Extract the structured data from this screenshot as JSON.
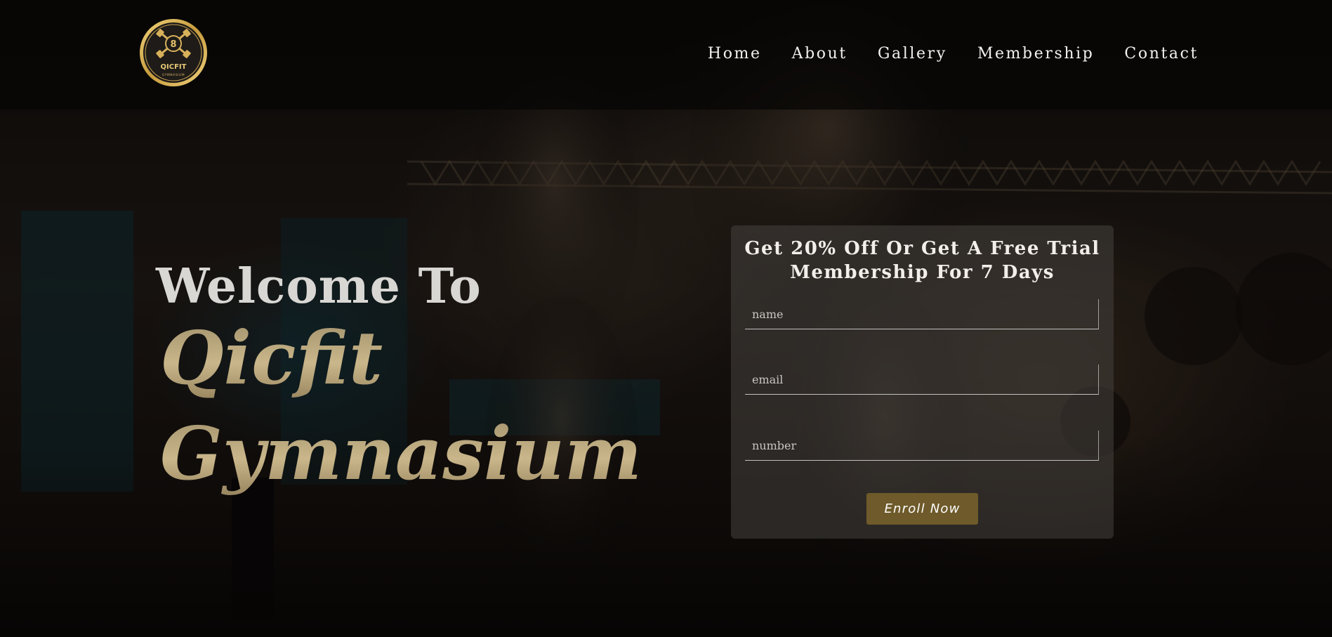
{
  "brand": {
    "logo_alt": "Qicfit Gymnasium logo",
    "logo_text": "QICFIT",
    "logo_subtext": "GYMNASIUM",
    "logo_number": "8"
  },
  "nav": {
    "items": [
      {
        "label": "Home"
      },
      {
        "label": "About"
      },
      {
        "label": "Gallery"
      },
      {
        "label": "Membership"
      },
      {
        "label": "Contact"
      }
    ]
  },
  "hero": {
    "welcome": "Welcome To",
    "brand_line1": "Qicfit",
    "brand_line2": "Gymnasium"
  },
  "form": {
    "title_line1": "Get 20% Off Or Get A Free Trial",
    "title_line2": "Membership For 7 Days",
    "fields": [
      {
        "placeholder": "name",
        "value": ""
      },
      {
        "placeholder": "email",
        "value": ""
      },
      {
        "placeholder": "number",
        "value": ""
      }
    ],
    "submit_label": "Enroll Now"
  },
  "colors": {
    "accent_gold": "#c9b68a",
    "button_bg": "#6e5a2a",
    "nav_text": "#f3f1ee"
  }
}
